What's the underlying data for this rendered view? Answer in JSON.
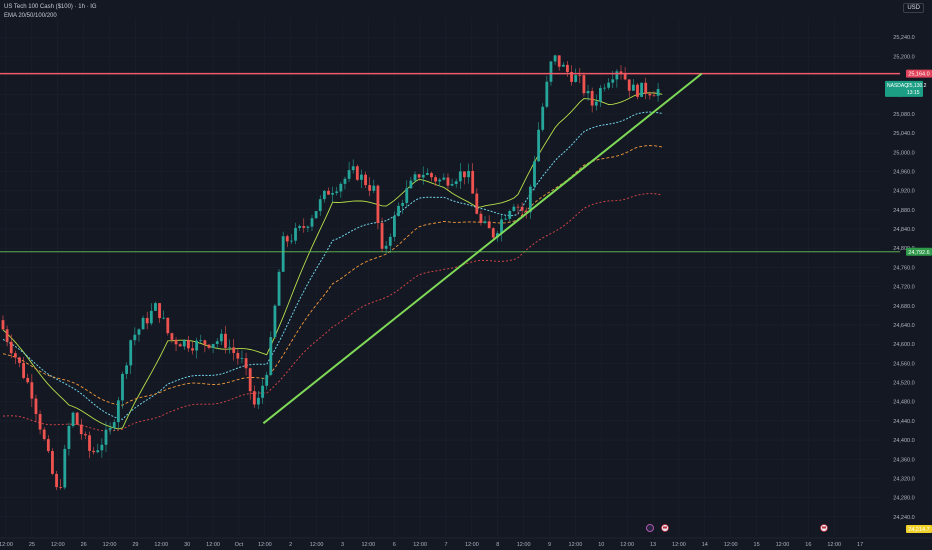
{
  "header": {
    "symbol_line": "US Tech 100 Cash ($100) · 1h · IG",
    "indicator_line": "EMA 20/50/100/200",
    "currency": "USD"
  },
  "colors": {
    "background": "#141823",
    "up": "#26a69a",
    "down": "#ef5350",
    "ema20": "#b8e04a",
    "ema50": "#6fd3e8",
    "ema100": "#f39a3c",
    "ema200": "#e04848",
    "resistance": "#f05a6a",
    "support": "#69c25a",
    "trendline": "#7ed957",
    "grid": "#1e2330"
  },
  "chart_data": {
    "type": "candlestick",
    "title": "US Tech 100 Cash ($100) · 1h · IG",
    "ylim": [
      24200,
      25280
    ],
    "yticks": [
      "25,240.0",
      "25,200.0",
      "25,120.0",
      "25,080.0",
      "25,040.0",
      "25,000.0",
      "24,960.0",
      "24,920.0",
      "24,880.0",
      "24,840.0",
      "24,800.0",
      "24,760.0",
      "24,720.0",
      "24,680.0",
      "24,640.0",
      "24,600.0",
      "24,560.0",
      "24,520.0",
      "24,480.0",
      "24,440.0",
      "24,400.0",
      "24,360.0",
      "24,320.0",
      "24,280.0",
      "24,240.0"
    ],
    "xticks": [
      "12:00",
      "25",
      "12:00",
      "26",
      "12:00",
      "29",
      "12:00",
      "30",
      "12:00",
      "Oct",
      "12:00",
      "2",
      "12:00",
      "3",
      "12:00",
      "6",
      "12:00",
      "7",
      "12:00",
      "8",
      "12:00",
      "9",
      "12:00",
      "10",
      "12:00",
      "13",
      "12:00",
      "14",
      "12:00",
      "15",
      "12:00",
      "16",
      "12:00",
      "17"
    ],
    "price_tags": [
      {
        "label": "25,164.0",
        "value": 25164,
        "kind": "resistance"
      },
      {
        "label": "NASDAQ",
        "value": 25130.2,
        "kind": "last",
        "price": "25,130.2",
        "timer": "13:15"
      },
      {
        "label": "24,792.6",
        "value": 24792.6,
        "kind": "support"
      },
      {
        "label": "24,214.7",
        "value": 24214.7,
        "kind": "low"
      }
    ],
    "horizontal_lines": [
      {
        "name": "resistance",
        "value": 25164
      },
      {
        "name": "support",
        "value": 24792.6
      }
    ],
    "trendline": {
      "x": [
        39.5,
        106
      ],
      "y": [
        24435,
        25164
      ]
    },
    "ema_anchor_points": {
      "ema20": [
        [
          0,
          24630
        ],
        [
          10,
          24470
        ],
        [
          18,
          24420
        ],
        [
          25,
          24610
        ],
        [
          40,
          24580
        ],
        [
          50,
          24900
        ],
        [
          58,
          24890
        ],
        [
          63,
          24940
        ],
        [
          67,
          24930
        ],
        [
          72,
          24880
        ],
        [
          78,
          24910
        ],
        [
          84,
          25060
        ],
        [
          88,
          25110
        ],
        [
          92,
          25100
        ],
        [
          96,
          25120
        ]
      ],
      "ema50": [
        [
          0,
          24610
        ],
        [
          10,
          24510
        ],
        [
          18,
          24440
        ],
        [
          25,
          24520
        ],
        [
          40,
          24560
        ],
        [
          50,
          24820
        ],
        [
          58,
          24860
        ],
        [
          63,
          24900
        ],
        [
          67,
          24910
        ],
        [
          72,
          24880
        ],
        [
          78,
          24870
        ],
        [
          84,
          24990
        ],
        [
          88,
          25040
        ],
        [
          92,
          25060
        ],
        [
          96,
          25080
        ]
      ],
      "ema100": [
        [
          0,
          24580
        ],
        [
          10,
          24520
        ],
        [
          18,
          24470
        ],
        [
          25,
          24510
        ],
        [
          40,
          24530
        ],
        [
          50,
          24730
        ],
        [
          58,
          24790
        ],
        [
          63,
          24840
        ],
        [
          67,
          24860
        ],
        [
          72,
          24850
        ],
        [
          78,
          24860
        ],
        [
          84,
          24930
        ],
        [
          88,
          24970
        ],
        [
          92,
          24990
        ],
        [
          96,
          25010
        ]
      ],
      "ema200": [
        [
          0,
          24450
        ],
        [
          10,
          24430
        ],
        [
          18,
          24420
        ],
        [
          25,
          24460
        ],
        [
          40,
          24500
        ],
        [
          50,
          24640
        ],
        [
          58,
          24700
        ],
        [
          63,
          24740
        ],
        [
          67,
          24760
        ],
        [
          72,
          24770
        ],
        [
          78,
          24780
        ],
        [
          84,
          24840
        ],
        [
          88,
          24880
        ],
        [
          92,
          24900
        ],
        [
          96,
          24910
        ]
      ]
    },
    "candle_anchor_points": [
      [
        0,
        24650
      ],
      [
        5,
        24500
      ],
      [
        9,
        24280
      ],
      [
        11,
        24460
      ],
      [
        14,
        24370
      ],
      [
        17,
        24420
      ],
      [
        20,
        24610
      ],
      [
        24,
        24680
      ],
      [
        26,
        24610
      ],
      [
        30,
        24600
      ],
      [
        34,
        24610
      ],
      [
        37,
        24560
      ],
      [
        39,
        24460
      ],
      [
        41,
        24570
      ],
      [
        43,
        24810
      ],
      [
        46,
        24840
      ],
      [
        50,
        24920
      ],
      [
        54,
        24960
      ],
      [
        57,
        24920
      ],
      [
        58,
        24780
      ],
      [
        61,
        24900
      ],
      [
        64,
        24960
      ],
      [
        67,
        24940
      ],
      [
        71,
        24960
      ],
      [
        73,
        24850
      ],
      [
        75,
        24830
      ],
      [
        78,
        24900
      ],
      [
        80,
        24870
      ],
      [
        82,
        25060
      ],
      [
        84,
        25200
      ],
      [
        86,
        25170
      ],
      [
        88,
        25150
      ],
      [
        90,
        25100
      ],
      [
        92,
        25150
      ],
      [
        94,
        25180
      ],
      [
        96,
        25130
      ]
    ],
    "annotations": [
      "pink event marker",
      "flag event marker",
      "flag event marker"
    ]
  }
}
